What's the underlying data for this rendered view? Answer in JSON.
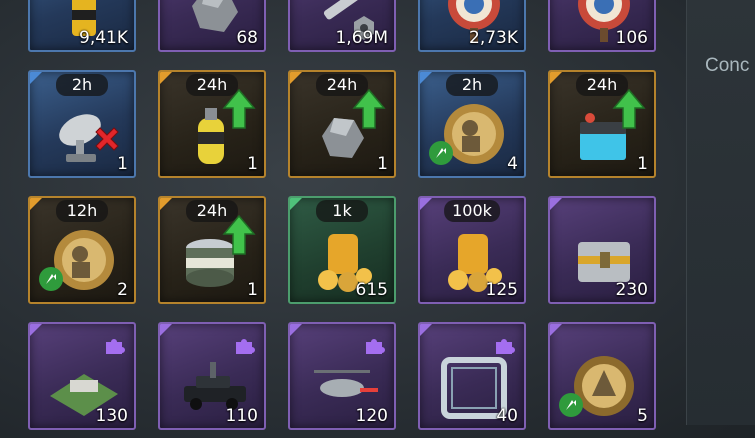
{
  "side_panel": {
    "label": "Conc"
  },
  "rows": [
    [
      {
        "id": "r0c0",
        "rarity": "blue",
        "timer": "",
        "count": "9,41K",
        "icon": "fuel-canister-icon"
      },
      {
        "id": "r0c1",
        "rarity": "purple",
        "timer": "",
        "count": "68",
        "icon": "iron-ore-icon"
      },
      {
        "id": "r0c2",
        "rarity": "purple",
        "timer": "",
        "count": "1,69M",
        "icon": "bolt-nut-icon"
      },
      {
        "id": "r0c3",
        "rarity": "blue",
        "timer": "",
        "count": "2,73K",
        "icon": "target-icon"
      },
      {
        "id": "r0c4",
        "rarity": "purple",
        "timer": "",
        "count": "106",
        "icon": "target-icon"
      }
    ],
    [
      {
        "id": "r1c0",
        "rarity": "blue",
        "timer": "2h",
        "count": "1",
        "icon": "radar-dish-icon",
        "overlay": "red-x"
      },
      {
        "id": "r1c1",
        "rarity": "gold",
        "timer": "24h",
        "count": "1",
        "icon": "ch4-canister-icon",
        "overlay": "green-up-arrow"
      },
      {
        "id": "r1c2",
        "rarity": "gold",
        "timer": "24h",
        "count": "1",
        "icon": "iron-ore-icon",
        "overlay": "green-up-arrow"
      },
      {
        "id": "r1c3",
        "rarity": "blue",
        "timer": "2h",
        "count": "4",
        "icon": "soldier-gear-icon",
        "overlay": "small-up-arrow"
      },
      {
        "id": "r1c4",
        "rarity": "gold",
        "timer": "24h",
        "count": "1",
        "icon": "research-device-icon",
        "overlay": "green-up-arrow"
      }
    ],
    [
      {
        "id": "r2c0",
        "rarity": "gold",
        "timer": "12h",
        "count": "2",
        "icon": "soldier-gear-icon",
        "overlay": "small-up-arrow"
      },
      {
        "id": "r2c1",
        "rarity": "gold",
        "timer": "24h",
        "count": "1",
        "icon": "meat-can-icon",
        "overlay": "green-up-arrow"
      },
      {
        "id": "r2c2",
        "rarity": "green",
        "timer": "1k",
        "count": "615",
        "icon": "gold-coins-jar-icon"
      },
      {
        "id": "r2c3",
        "rarity": "purple",
        "timer": "100k",
        "count": "125",
        "icon": "gold-coins-jar-icon"
      },
      {
        "id": "r2c4",
        "rarity": "purple",
        "timer": "",
        "count": "230",
        "icon": "supply-crate-icon"
      }
    ],
    [
      {
        "id": "r3c0",
        "rarity": "purple",
        "timer": "",
        "count": "130",
        "icon": "base-island-icon",
        "overlay": "puzzle-piece"
      },
      {
        "id": "r3c1",
        "rarity": "purple",
        "timer": "",
        "count": "110",
        "icon": "armored-car-icon",
        "overlay": "puzzle-piece"
      },
      {
        "id": "r3c2",
        "rarity": "purple",
        "timer": "",
        "count": "120",
        "icon": "helicopter-icon",
        "overlay": "puzzle-piece"
      },
      {
        "id": "r3c3",
        "rarity": "purple",
        "timer": "",
        "count": "40",
        "icon": "avatar-frame-icon",
        "overlay": "puzzle-piece"
      },
      {
        "id": "r3c4",
        "rarity": "purple",
        "timer": "",
        "count": "5",
        "icon": "rider-gear-icon",
        "overlay": "small-up-arrow"
      }
    ]
  ]
}
